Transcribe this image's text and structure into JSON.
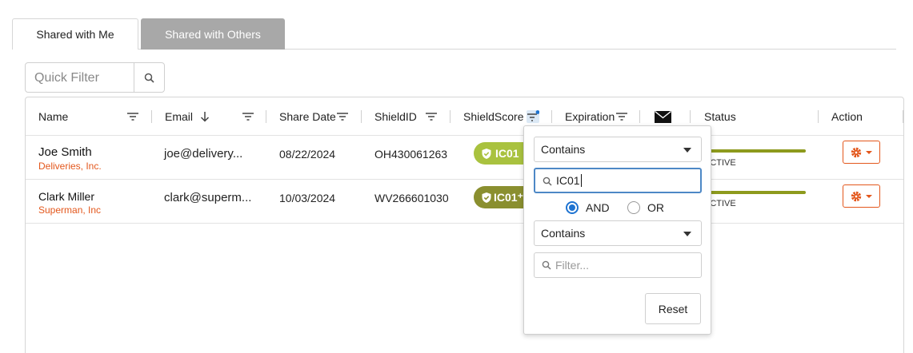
{
  "tabs": [
    {
      "label": "Shared with Me",
      "active": true
    },
    {
      "label": "Shared with Others",
      "active": false
    }
  ],
  "quick_filter": {
    "placeholder": "Quick Filter",
    "icon": "search-icon"
  },
  "columns": {
    "name": "Name",
    "email": "Email",
    "share_date": "Share Date",
    "shield_id": "ShieldID",
    "shield_score": "ShieldScore",
    "expiration": "Expiration",
    "status": "Status",
    "action": "Action"
  },
  "rows": [
    {
      "name": "Joe Smith",
      "company": "Deliveries, Inc.",
      "email": "joe@delivery...",
      "share_date": "08/22/2024",
      "shield_id": "OH430061263",
      "shield_score": "IC01",
      "score_color": "#a9c23f",
      "status": "ACTIVE"
    },
    {
      "name": "Clark Miller",
      "company": "Superman, Inc",
      "email": "clark@superm...",
      "share_date": "10/03/2024",
      "shield_id": "WV266601030",
      "shield_score": "IC01⁺",
      "score_color": "#8a8f2f",
      "status": "ACTIVE"
    }
  ],
  "filter_popup": {
    "condition1": "Contains",
    "value1": "IC01",
    "operator_and": "AND",
    "operator_or": "OR",
    "selected_operator": "AND",
    "condition2": "Contains",
    "value2_placeholder": "Filter...",
    "reset_label": "Reset"
  },
  "colors": {
    "accent_orange": "#e3571c",
    "status_green": "#8d9a1d",
    "focus_blue": "#4d88c6",
    "radio_blue": "#1e73d1"
  }
}
